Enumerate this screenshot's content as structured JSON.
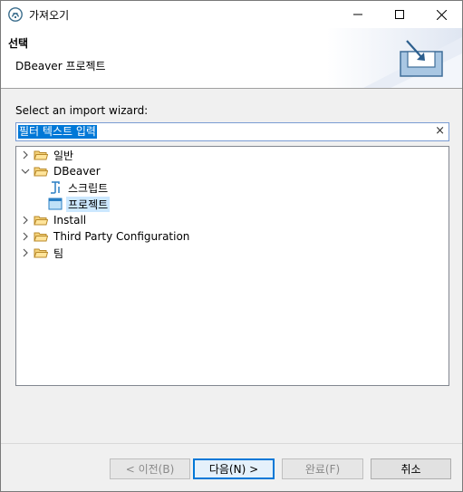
{
  "window": {
    "title": "가져오기"
  },
  "banner": {
    "title": "선택",
    "description": "DBeaver 프로젝트"
  },
  "wizard": {
    "select_label": "Select an import wizard:",
    "filter_value": "필터 텍스트 입력",
    "clear_symbol": "×"
  },
  "tree": {
    "items": [
      {
        "label": "일반",
        "expanded": false,
        "icon": "folder-icon"
      },
      {
        "label": "DBeaver",
        "expanded": true,
        "icon": "folder-open-icon"
      },
      {
        "label": "스크립트",
        "icon": "script-icon"
      },
      {
        "label": "프로젝트",
        "icon": "project-icon",
        "selected": true
      },
      {
        "label": "Install",
        "expanded": false,
        "icon": "folder-icon"
      },
      {
        "label": "Third Party Configuration",
        "expanded": false,
        "icon": "folder-icon"
      },
      {
        "label": "팀",
        "expanded": false,
        "icon": "folder-icon"
      }
    ]
  },
  "buttons": {
    "back": "< 이전(B)",
    "next": "다음(N) >",
    "finish": "완료(F)",
    "cancel": "취소"
  }
}
